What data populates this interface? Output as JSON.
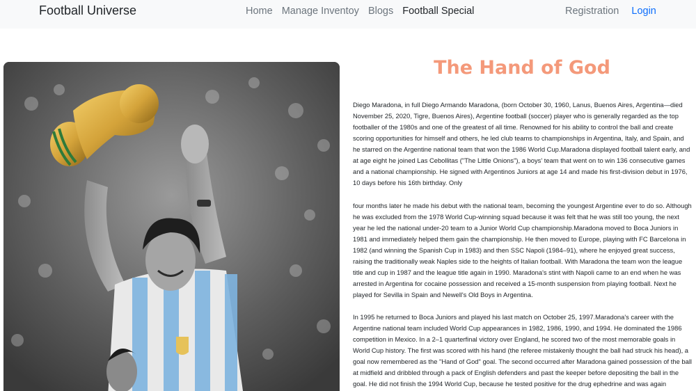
{
  "navbar": {
    "brand": "Football Universe",
    "links": [
      "Home",
      "Manage Inventoy",
      "Blogs",
      "Football Special"
    ],
    "registration": "Registration",
    "login": "Login"
  },
  "article": {
    "title": "The Hand of God",
    "image_alt": "Diego Maradona raising the World Cup trophy",
    "paragraphs": [
      "Diego Maradona, in full Diego Armando Maradona, (born October 30, 1960, Lanus, Buenos Aires, Argentina—died November 25, 2020, Tigre, Buenos Aires), Argentine football (soccer) player who is generally regarded as the top footballer of the 1980s and one of the greatest of all time. Renowned for his ability to control the ball and create scoring opportunities for himself and others, he led club teams to championships in Argentina, Italy, and Spain, and he starred on the Argentine national team that won the 1986 World Cup.Maradona displayed football talent early, and at age eight he joined Las Cebollitas (\"The Little Onions\"), a boys' team that went on to win 136 consecutive games and a national championship. He signed with Argentinos Juniors at age 14 and made his first-division debut in 1976, 10 days before his 16th birthday. Only",
      "four months later he made his debut with the national team, becoming the youngest Argentine ever to do so. Although he was excluded from the 1978 World Cup-winning squad because it was felt that he was still too young, the next year he led the national under-20 team to a Junior World Cup championship.Maradona moved to Boca Juniors in 1981 and immediately helped them gain the championship. He then moved to Europe, playing with FC Barcelona in 1982 (and winning the Spanish Cup in 1983) and then SSC Napoli (1984–91), where he enjoyed great success, raising the traditionally weak Naples side to the heights of Italian football. With Maradona the team won the league title and cup in 1987 and the league title again in 1990. Maradona's stint with Napoli came to an end when he was arrested in Argentina for cocaine possession and received a 15-month suspension from playing football. Next he played for Sevilla in Spain and Newell's Old Boys in Argentina.",
      "In 1995 he returned to Boca Juniors and played his last match on October 25, 1997.Maradona's career with the Argentine national team included World Cup appearances in 1982, 1986, 1990, and 1994. He dominated the 1986 competition in Mexico. In a 2–1 quarterfinal victory over England, he scored two of the most memorable goals in World Cup history. The first was scored with his hand (the referee mistakenly thought the ball had struck his head), a goal now remembered as the \"Hand of God\" goal. The second occurred after Maradona gained possession of the ball at midfield and dribbled through a pack of English defenders and past the keeper before depositing the ball in the goal. He did not finish the 1994 World Cup, because he tested positive for the drug ephedrine and was again suspended. Maradona also played on South American championship-"
    ]
  },
  "colors": {
    "title": "#f4997a",
    "login": "#0d6efd",
    "navbar_bg": "#f8f9fa",
    "trophy_gold": "#d4a33a",
    "shirt_blue": "#7fb4e0"
  }
}
